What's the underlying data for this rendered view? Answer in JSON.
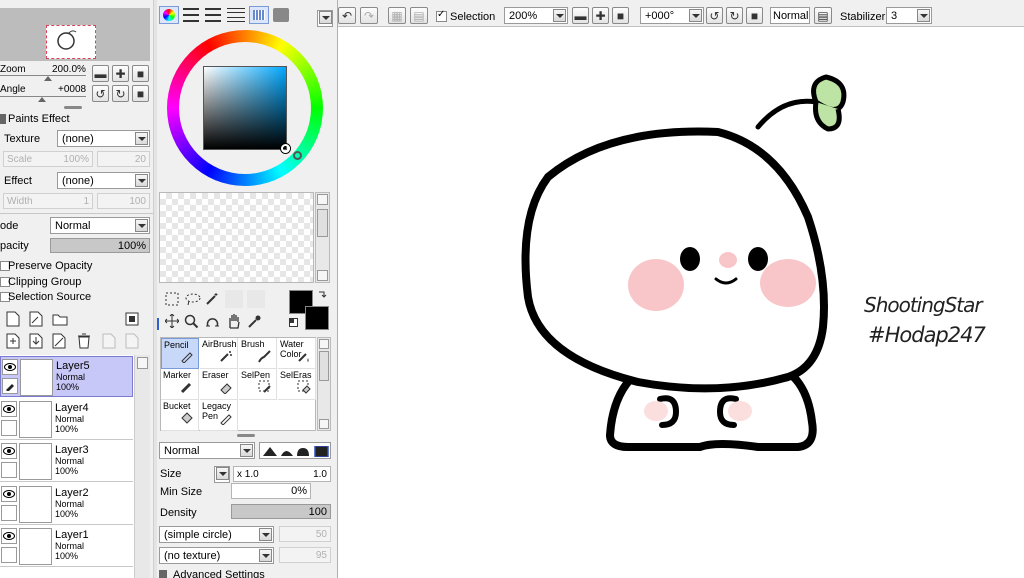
{
  "navigator": {
    "zoom_label": "Zoom",
    "zoom_value": "200.0%",
    "angle_label": "Angle",
    "angle_value": "+0008"
  },
  "paints_effect": {
    "title": "Paints Effect",
    "texture_label": "Texture",
    "texture_value": "(none)",
    "scale_label": "Scale",
    "scale_value": "100%",
    "scale_num": "20",
    "effect_label": "Effect",
    "effect_value": "(none)",
    "width_label": "Width",
    "width_value": "1",
    "width_num": "100"
  },
  "layer_props": {
    "mode_label": "ode",
    "mode_value": "Normal",
    "opacity_label": "pacity",
    "opacity_value": "100%",
    "opacity_fraction": 1.0,
    "preserve_opacity": "Preserve Opacity",
    "clipping_group": "Clipping Group",
    "selection_source": "Selection Source"
  },
  "layers": [
    {
      "name": "Layer5",
      "mode": "Normal",
      "opacity": "100%",
      "selected": true
    },
    {
      "name": "Layer4",
      "mode": "Normal",
      "opacity": "100%",
      "selected": false
    },
    {
      "name": "Layer3",
      "mode": "Normal",
      "opacity": "100%",
      "selected": false
    },
    {
      "name": "Layer2",
      "mode": "Normal",
      "opacity": "100%",
      "selected": false
    },
    {
      "name": "Layer1",
      "mode": "Normal",
      "opacity": "100%",
      "selected": false
    }
  ],
  "tools": [
    {
      "label": "Pencil",
      "selected": true
    },
    {
      "label": "AirBrush",
      "selected": false
    },
    {
      "label": "Brush",
      "selected": false
    },
    {
      "label": "Water Color",
      "selected": false
    },
    {
      "label": "Marker",
      "selected": false
    },
    {
      "label": "Eraser",
      "selected": false
    },
    {
      "label": "SelPen",
      "selected": false
    },
    {
      "label": "SelEras",
      "selected": false
    },
    {
      "label": "Bucket",
      "selected": false
    },
    {
      "label": "Legacy Pen",
      "selected": false
    }
  ],
  "brush": {
    "blend_mode": "Normal",
    "size_label": "Size",
    "size_multiplier": "x 1.0",
    "size_value": "1.0",
    "min_size_label": "Min Size",
    "min_size_value": "0%",
    "density_label": "Density",
    "density_value": "100",
    "shape": "(simple circle)",
    "shape_num": "50",
    "texture": "(no texture)",
    "texture_num": "95",
    "advanced_settings": "Advanced Settings"
  },
  "toolbar": {
    "selection_label": "Selection",
    "zoom_value": "200%",
    "angle_value": "+000°",
    "mode_value": "Normal",
    "stabilizer_label": "Stabilizer",
    "stabilizer_value": "3"
  },
  "canvas": {
    "signature_line1": "ShootingStar",
    "signature_line2": "#Hodap247"
  },
  "colors": {
    "primary": "#000000",
    "secondary": "#000000",
    "selected_layer": "#c8c8f8",
    "blush": "#f8c8c8",
    "sprout": "#b8e0a0"
  }
}
